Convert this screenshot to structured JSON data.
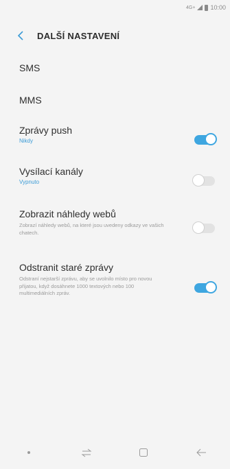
{
  "status_bar": {
    "network": "4G+",
    "time": "10:00"
  },
  "app_bar": {
    "title": "DALŠÍ NASTAVENÍ"
  },
  "settings": {
    "sms": {
      "label": "SMS"
    },
    "mms": {
      "label": "MMS"
    },
    "push": {
      "label": "Zprávy push",
      "value": "Nikdy",
      "enabled": true
    },
    "broadcast": {
      "label": "Vysílací kanály",
      "value": "Vypnuto",
      "enabled": false
    },
    "web_preview": {
      "label": "Zobrazit náhledy webů",
      "description": "Zobrazí náhledy webů, na které jsou uvedeny odkazy ve vašich chatech.",
      "enabled": false
    },
    "delete_old": {
      "label": "Odstranit staré zprávy",
      "description": "Odstraní nejstarší zprávu, aby se uvolnilo místo pro novou přijatou, když dosáhnete 1000 textových nebo 100 multimediálních zpráv.",
      "enabled": true
    }
  },
  "colors": {
    "accent": "#3ea6e0",
    "background": "#f4f4f4"
  },
  "nav_icons": [
    "dot-icon",
    "recents-icon",
    "home-icon",
    "back-arrow-icon"
  ]
}
